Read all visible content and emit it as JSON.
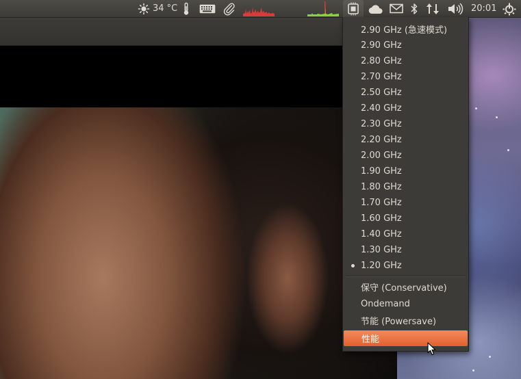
{
  "panel": {
    "weather_temp": "34 °C",
    "clock": "20:01",
    "indicators": [
      "weather-sun-icon",
      "thermometer-icon",
      "keyboard-icon",
      "paperclip-icon",
      "system-monitor-graph",
      "network-graph",
      "cpufreq-icon",
      "cloud-icon",
      "mail-icon",
      "bluetooth-icon",
      "network-updown-icon",
      "volume-icon",
      "session-icon"
    ]
  },
  "menu": {
    "frequencies": [
      {
        "label": "2.90 GHz (急速模式)",
        "selected": false
      },
      {
        "label": "2.90 GHz",
        "selected": false
      },
      {
        "label": "2.80 GHz",
        "selected": false
      },
      {
        "label": "2.70 GHz",
        "selected": false
      },
      {
        "label": "2.50 GHz",
        "selected": false
      },
      {
        "label": "2.40 GHz",
        "selected": false
      },
      {
        "label": "2.30 GHz",
        "selected": false
      },
      {
        "label": "2.20 GHz",
        "selected": false
      },
      {
        "label": "2.00 GHz",
        "selected": false
      },
      {
        "label": "1.90 GHz",
        "selected": false
      },
      {
        "label": "1.80 GHz",
        "selected": false
      },
      {
        "label": "1.70 GHz",
        "selected": false
      },
      {
        "label": "1.60 GHz",
        "selected": false
      },
      {
        "label": "1.40 GHz",
        "selected": false
      },
      {
        "label": "1.30 GHz",
        "selected": false
      },
      {
        "label": "1.20 GHz",
        "selected": true
      }
    ],
    "governors": [
      {
        "label": "保守 (Conservative)",
        "highlighted": false
      },
      {
        "label": "Ondemand",
        "highlighted": false
      },
      {
        "label": "节能 (Powersave)",
        "highlighted": false
      },
      {
        "label": "性能",
        "highlighted": true
      }
    ]
  },
  "colors": {
    "panel_bg": "#3c3b37",
    "menu_bg": "#3c3b37",
    "menu_text": "#dfdbd2",
    "highlight": "#e8693a",
    "graph_red": "#d93a3a",
    "graph_green": "#8ad13a"
  }
}
